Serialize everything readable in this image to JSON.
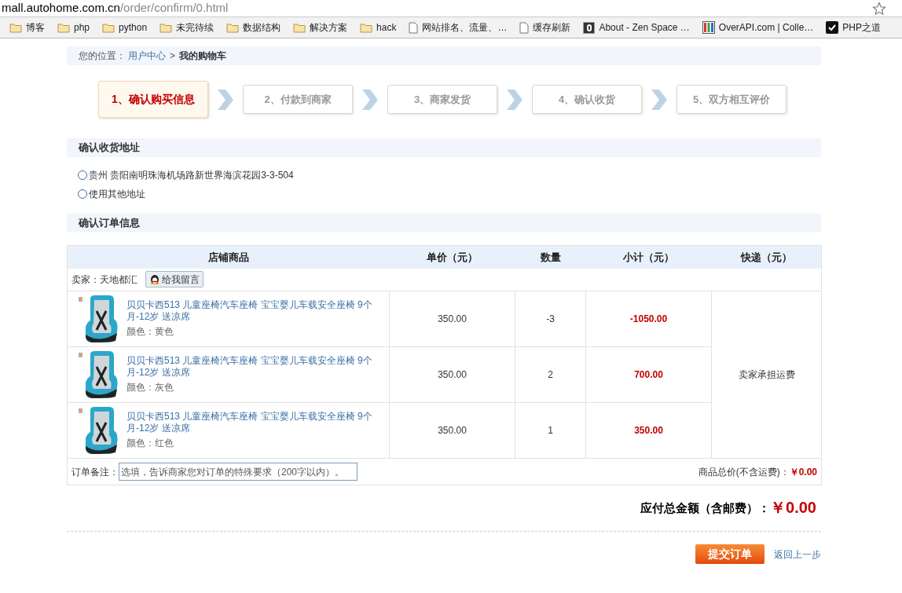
{
  "browser": {
    "url_host": "mall.autohome.com.cn",
    "url_path": "/order/confirm/0.html",
    "bookmarks": [
      {
        "kind": "folder",
        "label": "博客"
      },
      {
        "kind": "folder",
        "label": "php"
      },
      {
        "kind": "folder",
        "label": "python"
      },
      {
        "kind": "folder",
        "label": "未完待续"
      },
      {
        "kind": "folder",
        "label": "数据结构"
      },
      {
        "kind": "folder",
        "label": "解决方案"
      },
      {
        "kind": "folder",
        "label": "hack"
      },
      {
        "kind": "page",
        "label": "网站排名、流量、…"
      },
      {
        "kind": "page",
        "label": "缓存刷新"
      },
      {
        "kind": "zen",
        "label": "About - Zen Space …"
      },
      {
        "kind": "overapi",
        "label": "OverAPI.com | Colle…"
      },
      {
        "kind": "check",
        "label": "PHP之道"
      }
    ]
  },
  "breadcrumb": {
    "prefix": "您的位置：",
    "link": "用户中心",
    "separator": ">",
    "current": "我的购物车"
  },
  "steps": [
    {
      "label": "1、确认购买信息",
      "selected": true
    },
    {
      "label": "2、付款到商家",
      "selected": false
    },
    {
      "label": "3、商家发货",
      "selected": false
    },
    {
      "label": "4、确认收货",
      "selected": false
    },
    {
      "label": "5、双方相互评价",
      "selected": false
    }
  ],
  "address_section": {
    "title": "确认收货地址",
    "options": [
      {
        "label": "贵州 贵阳南明珠海机场路新世界海滨花园3-3-504",
        "selected": false
      },
      {
        "label": "使用其他地址",
        "selected": false
      }
    ]
  },
  "order_section": {
    "title": "确认订单信息"
  },
  "table": {
    "columns": [
      "店铺商品",
      "单价（元）",
      "数量",
      "小计（元）",
      "快递（元）"
    ],
    "seller_label": "卖家：天地都汇",
    "message_button": "给我留言",
    "rows": [
      {
        "name": "贝贝卡西513 儿童座椅汽车座椅 宝宝婴儿车载安全座椅 9个月-12岁 送凉席",
        "variant": "颜色：黄色",
        "price": "350.00",
        "quantity": "-3",
        "subtotal": "-1050.00"
      },
      {
        "name": "贝贝卡西513 儿童座椅汽车座椅 宝宝婴儿车载安全座椅 9个月-12岁 送凉席",
        "variant": "颜色：灰色",
        "price": "350.00",
        "quantity": "2",
        "subtotal": "700.00"
      },
      {
        "name": "贝贝卡西513 儿童座椅汽车座椅 宝宝婴儿车载安全座椅 9个月-12岁 送凉席",
        "variant": "颜色：红色",
        "price": "350.00",
        "quantity": "1",
        "subtotal": "350.00"
      }
    ],
    "shipping": "卖家承担运费",
    "note_label": "订单备注：",
    "note_placeholder": "选填，告诉商家您对订单的特殊要求（200字以内）。",
    "goods_total_label": "商品总价(不含运费)：",
    "goods_total": "￥0.00"
  },
  "total": {
    "label": "应付总金额（含邮费）：",
    "amount": "￥0.00"
  },
  "actions": {
    "submit": "提交订单",
    "back": "返回上一步"
  }
}
